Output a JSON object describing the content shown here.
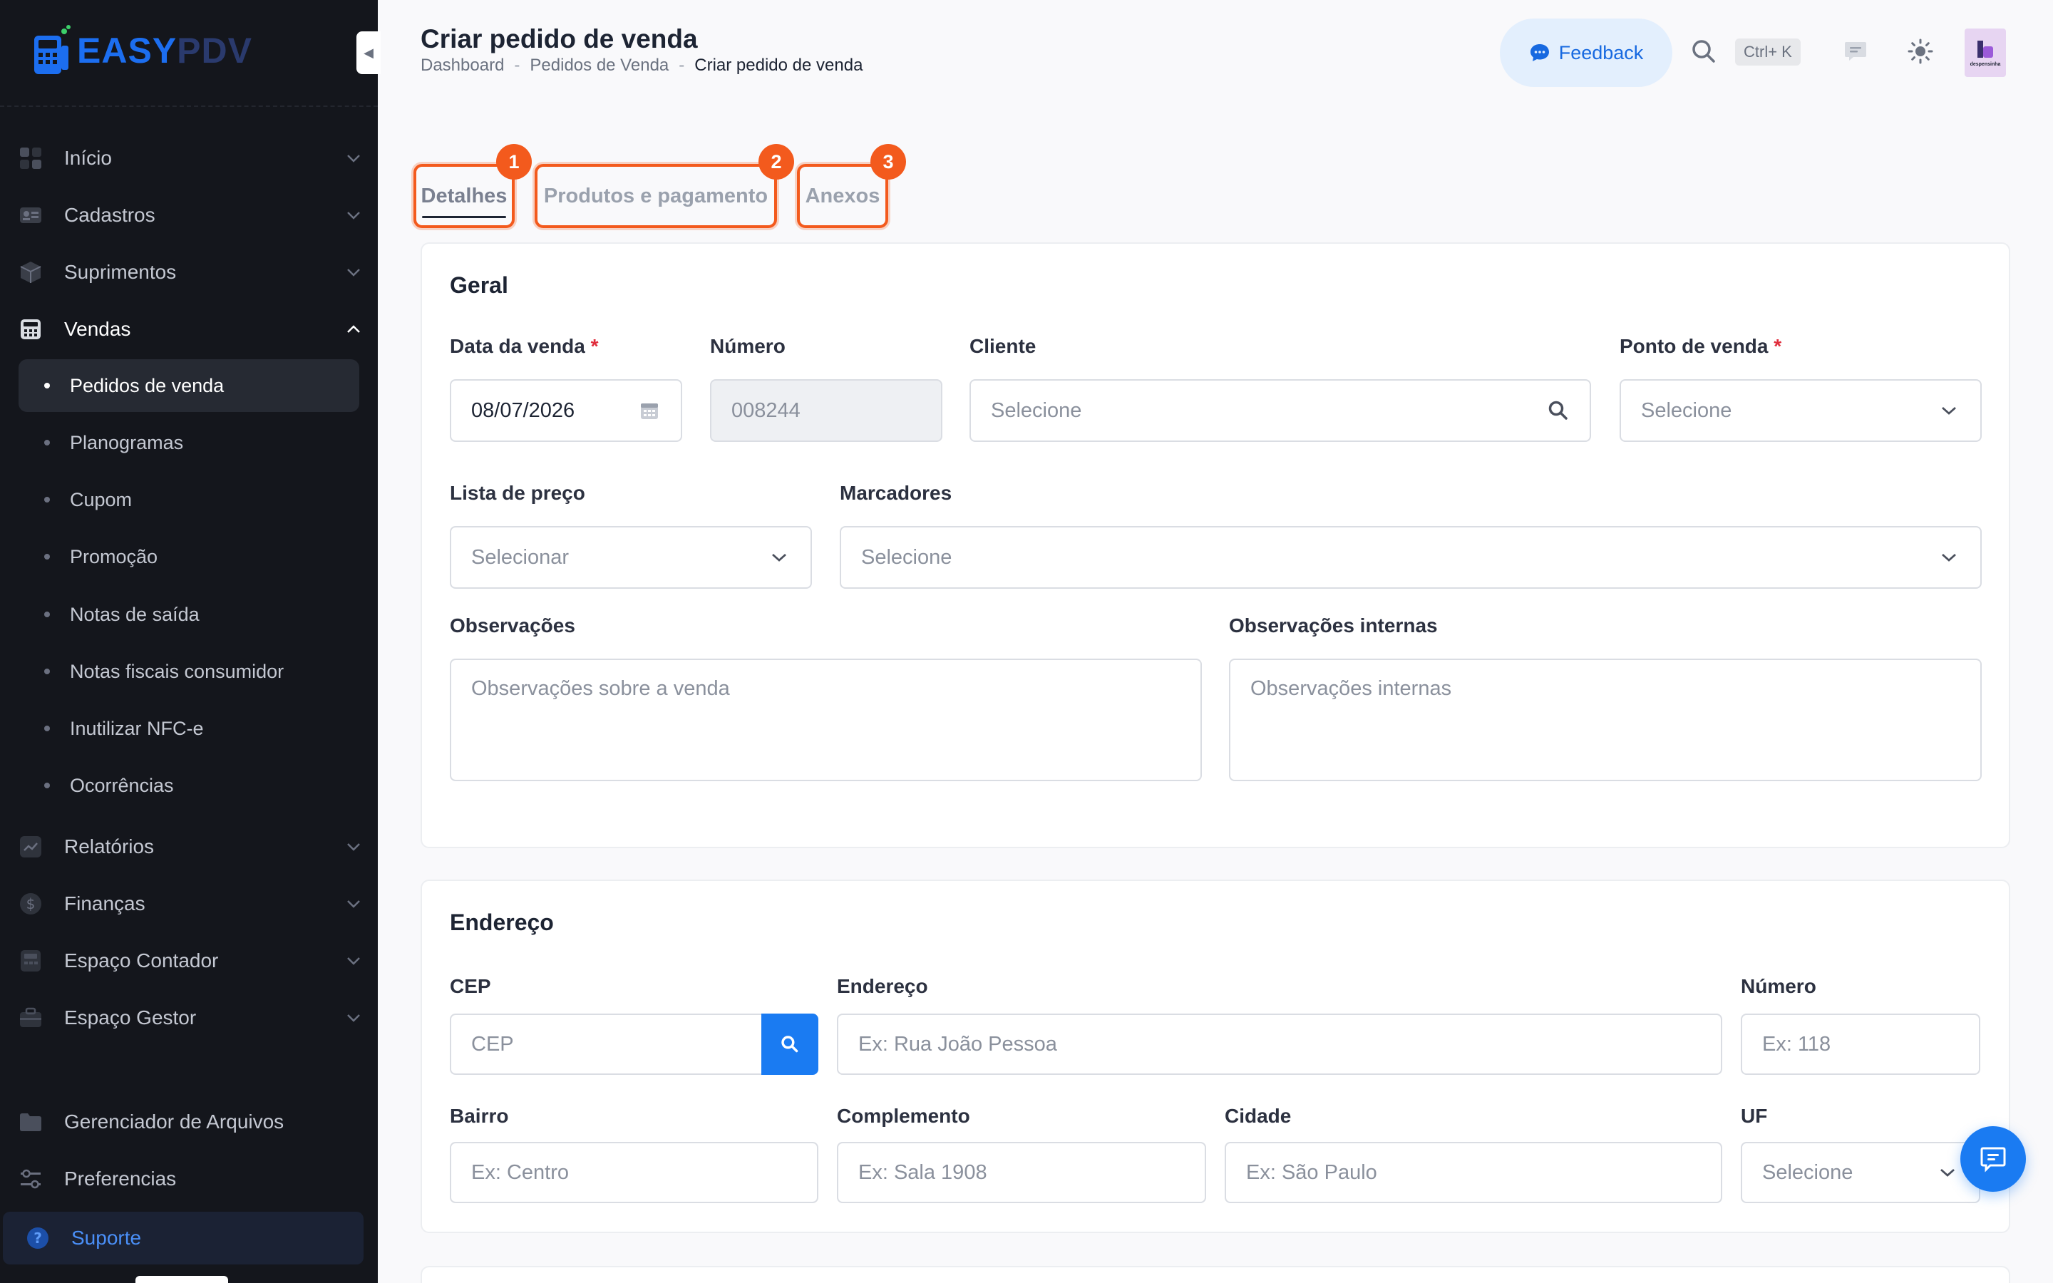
{
  "app": {
    "logo_easy": "EASY",
    "logo_pdv": "PDV",
    "brand_color": "#1c6ef0"
  },
  "sidebar": {
    "items": [
      {
        "label": "Início",
        "icon": "grid-icon"
      },
      {
        "label": "Cadastros",
        "icon": "id-card-icon"
      },
      {
        "label": "Suprimentos",
        "icon": "box-icon"
      },
      {
        "label": "Vendas",
        "icon": "register-icon"
      },
      {
        "label": "Relatórios",
        "icon": "chart-icon"
      },
      {
        "label": "Finanças",
        "icon": "dollar-icon"
      },
      {
        "label": "Espaço Contador",
        "icon": "calculator-icon"
      },
      {
        "label": "Espaço Gestor",
        "icon": "briefcase-icon"
      },
      {
        "label": "Gerenciador de Arquivos",
        "icon": "folder-icon"
      },
      {
        "label": "Preferencias",
        "icon": "sliders-icon"
      }
    ],
    "vendas_sub": [
      {
        "label": "Pedidos de venda"
      },
      {
        "label": "Planogramas"
      },
      {
        "label": "Cupom"
      },
      {
        "label": "Promoção"
      },
      {
        "label": "Notas de saída"
      },
      {
        "label": "Notas fiscais consumidor"
      },
      {
        "label": "Inutilizar NFC-e"
      },
      {
        "label": "Ocorrências"
      }
    ],
    "suporte": "Suporte"
  },
  "header": {
    "title": "Criar pedido de venda",
    "breadcrumb": [
      "Dashboard",
      "Pedidos de Venda",
      "Criar pedido de venda"
    ],
    "breadcrumb_sep": "-",
    "feedback": "Feedback",
    "shortcut": "Ctrl+ K",
    "avatar_text": "despensinha"
  },
  "tabs": [
    {
      "label": "Detalhes",
      "badge": "1"
    },
    {
      "label": "Produtos e pagamento",
      "badge": "2"
    },
    {
      "label": "Anexos",
      "badge": "3"
    }
  ],
  "geral": {
    "title": "Geral",
    "data_venda": {
      "label": "Data da venda",
      "required": "*",
      "value": "08/07/2026"
    },
    "numero": {
      "label": "Número",
      "value": "008244"
    },
    "cliente": {
      "label": "Cliente",
      "placeholder": "Selecione"
    },
    "ponto_venda": {
      "label": "Ponto de venda",
      "required": "*",
      "placeholder": "Selecione"
    },
    "lista_preco": {
      "label": "Lista de preço",
      "placeholder": "Selecionar"
    },
    "marcadores": {
      "label": "Marcadores",
      "placeholder": "Selecione"
    },
    "observacoes": {
      "label": "Observações",
      "placeholder": "Observações sobre a venda"
    },
    "observacoes_internas": {
      "label": "Observações internas",
      "placeholder": "Observações internas"
    }
  },
  "endereco": {
    "title": "Endereço",
    "cep": {
      "label": "CEP",
      "placeholder": "CEP"
    },
    "endereco": {
      "label": "Endereço",
      "placeholder": "Ex: Rua João Pessoa"
    },
    "numero": {
      "label": "Número",
      "placeholder": "Ex: 118"
    },
    "bairro": {
      "label": "Bairro",
      "placeholder": "Ex: Centro"
    },
    "complemento": {
      "label": "Complemento",
      "placeholder": "Ex: Sala 1908"
    },
    "cidade": {
      "label": "Cidade",
      "placeholder": "Ex: São Paulo"
    },
    "uf": {
      "label": "UF",
      "placeholder": "Selecione"
    }
  },
  "colors": {
    "accent": "#1a7bf2",
    "highlight": "#f35a1d",
    "sidebar_bg": "#14161c"
  }
}
